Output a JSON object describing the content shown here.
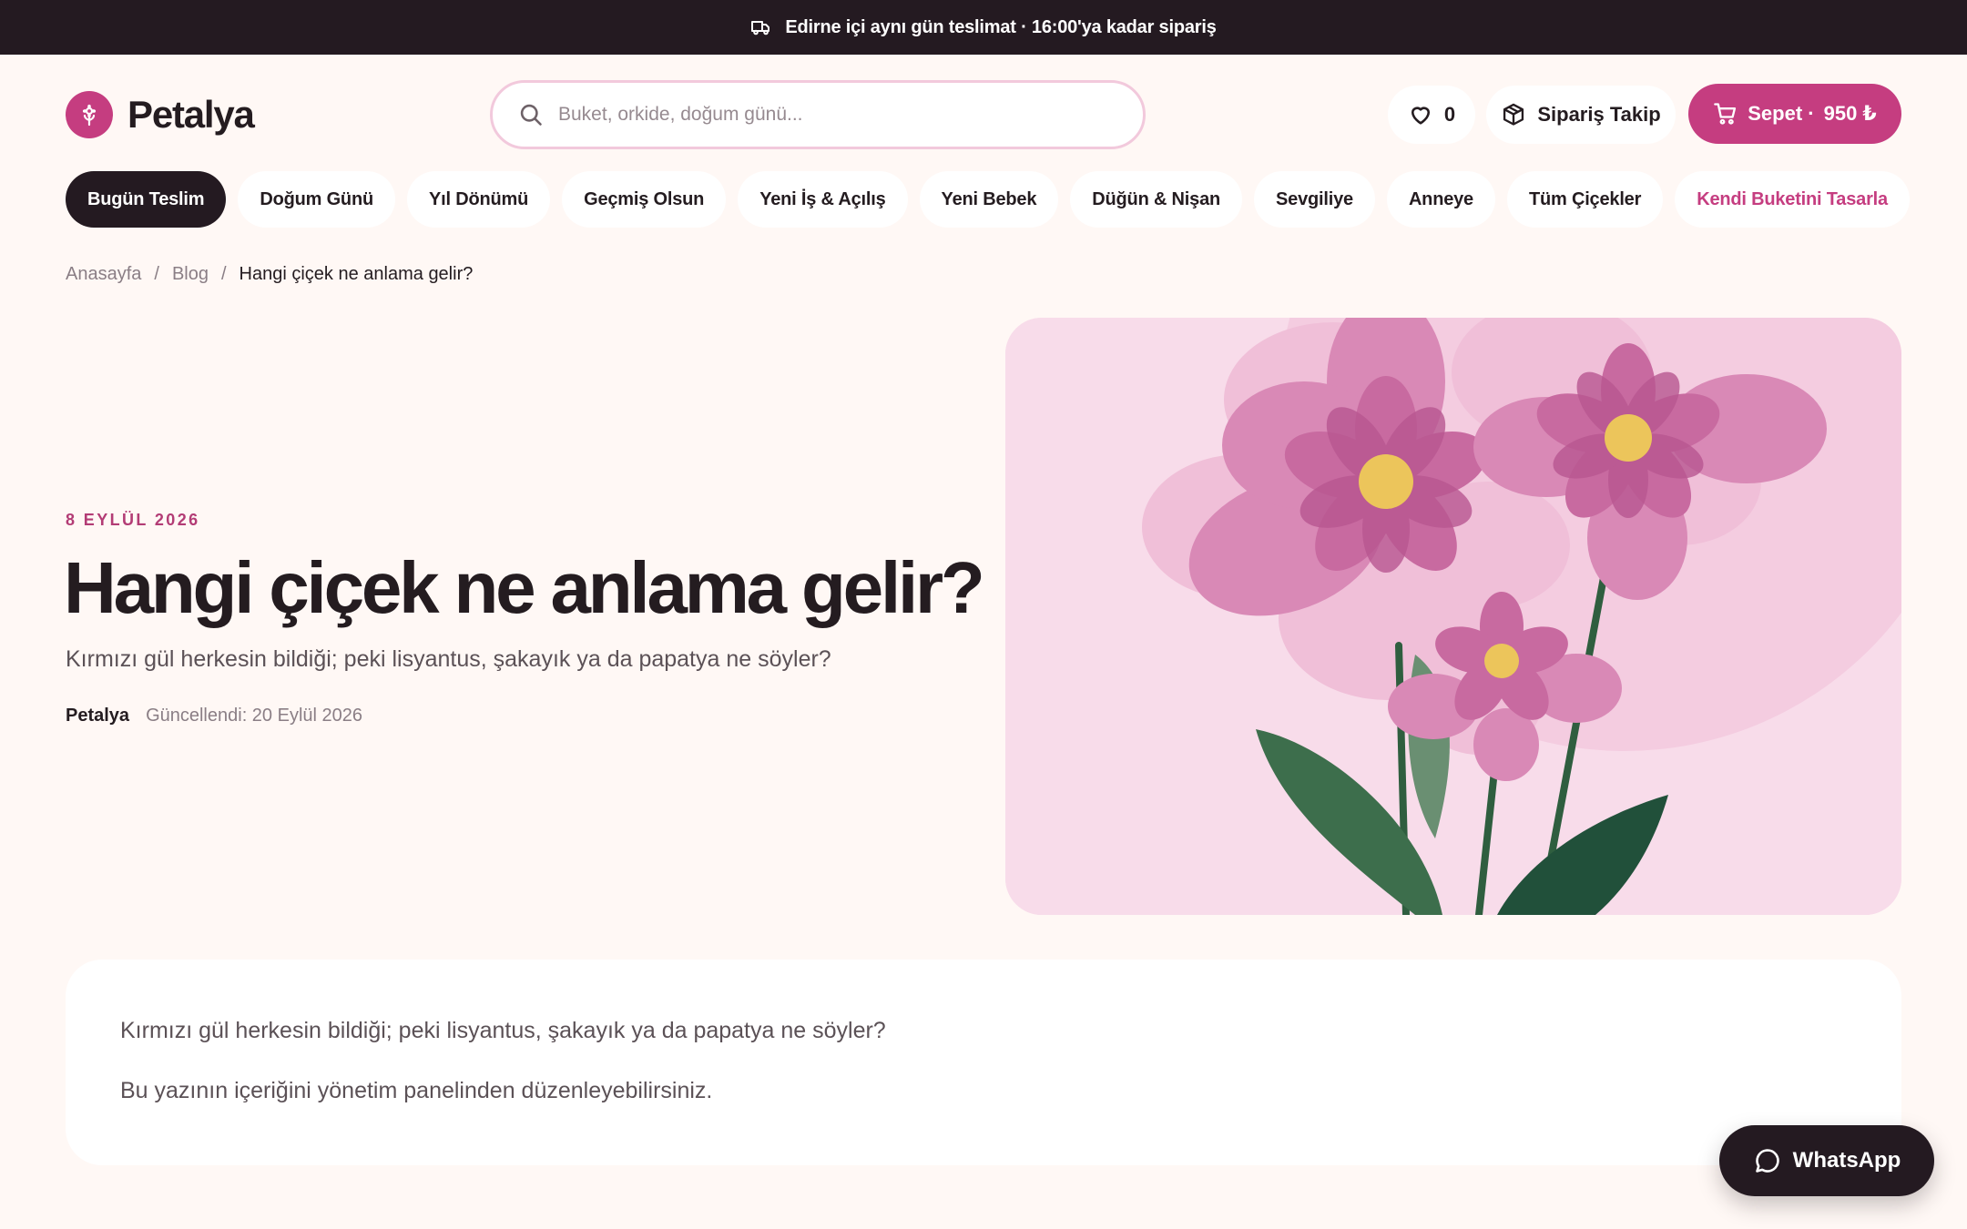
{
  "announcement": {
    "icon": "truck-icon",
    "text": "Edirne içi aynı gün teslimat · 16:00'ya kadar sipariş"
  },
  "brand": {
    "name": "Petalya",
    "icon": "flower-icon",
    "color": "#c53d80"
  },
  "search": {
    "placeholder": "Buket, orkide, doğum günü...",
    "value": ""
  },
  "header": {
    "favorites": {
      "icon": "heart-icon",
      "count": "0"
    },
    "order_tracking": {
      "icon": "package-icon",
      "label": "Sipariş Takip"
    },
    "cart": {
      "icon": "cart-icon",
      "label": "Sepet ·",
      "total": "950 ₺"
    }
  },
  "nav": {
    "items": [
      {
        "label": "Bugün Teslim",
        "active": true
      },
      {
        "label": "Doğum Günü"
      },
      {
        "label": "Yıl Dönümü"
      },
      {
        "label": "Geçmiş Olsun"
      },
      {
        "label": "Yeni İş & Açılış"
      },
      {
        "label": "Yeni Bebek"
      },
      {
        "label": "Düğün & Nişan"
      },
      {
        "label": "Sevgiliye"
      },
      {
        "label": "Anneye"
      },
      {
        "label": "Tüm Çiçekler"
      },
      {
        "label": "Kendi Buketini Tasarla",
        "accent": true
      }
    ]
  },
  "breadcrumb": {
    "home": "Anasayfa",
    "sep1": "/",
    "blog": "Blog",
    "sep2": "/",
    "current": "Hangi çiçek ne anlama gelir?"
  },
  "article": {
    "date": "8 EYLÜL 2026",
    "title": "Hangi çiçek ne anlama gelir?",
    "subtitle": "Kırmızı gül herkesin bildiği; peki lisyantus, şakayık ya da papatya ne söyler?",
    "author": "Petalya",
    "updated": "Güncellendi: 20 Eylül 2026",
    "body": [
      "Kırmızı gül herkesin bildiği; peki lisyantus, şakayık ya da papatya ne söyler?",
      "Bu yazının içeriğini yönetim panelinden düzenleyebilirsiniz."
    ]
  },
  "whatsapp": {
    "icon": "chat-bubble-icon",
    "label": "WhatsApp"
  },
  "colors": {
    "accent": "#c53d80",
    "dark": "#241a21",
    "background": "#fff8f5",
    "hero_bg": "#f8dcea",
    "leaf": "#3d6e4c",
    "petal": "#d989b6",
    "flower_center": "#ecc55b"
  }
}
